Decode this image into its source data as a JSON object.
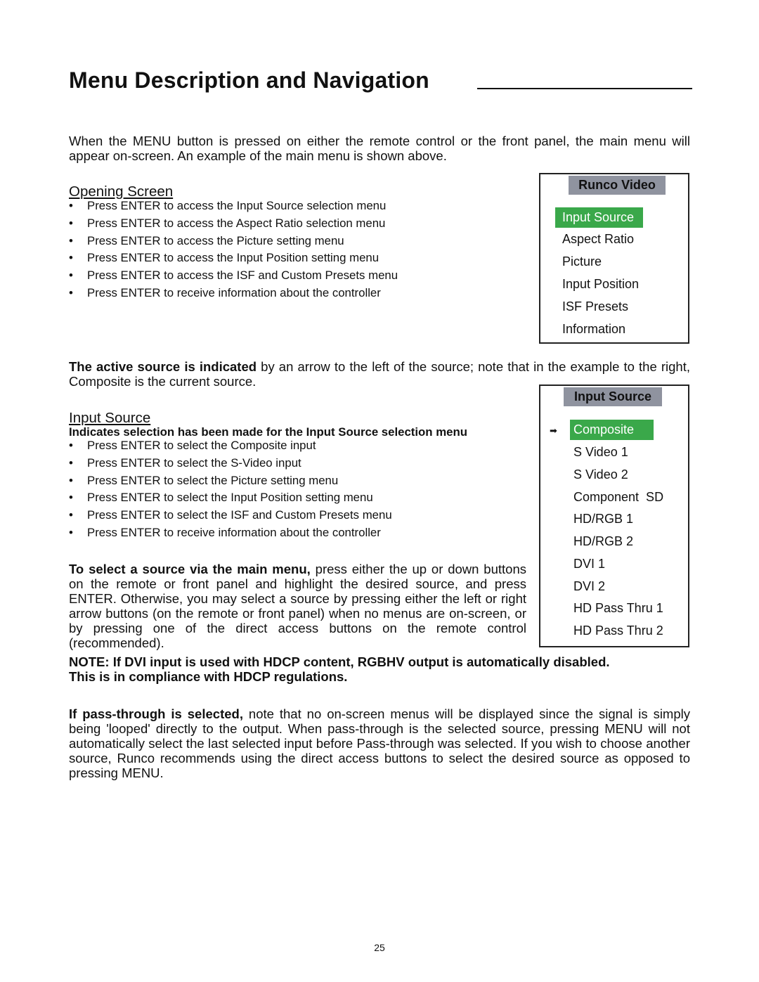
{
  "page": {
    "title": "Menu Description and Navigation",
    "intro": "When the MENU button is pressed on either the remote control or the front panel, the main menu will appear on-screen. An example of the main menu is shown above.",
    "opening_screen": {
      "heading": "Opening Screen",
      "bullets": [
        "Press ENTER to access the Input Source selection menu",
        "Press ENTER to access the Aspect Ratio selection menu",
        "Press ENTER to access the Picture setting menu",
        "Press ENTER to access the Input Position setting menu",
        "Press ENTER to access the ISF and Custom Presets menu",
        "Press ENTER to receive information about the controller"
      ]
    },
    "active_source": {
      "bold": "The active source is indicated",
      "rest": " by an arrow to the left of the source; note that in the example to the right, Composite is the current source."
    },
    "input_source": {
      "heading": "Input Source",
      "subheading": "Indicates selection has been made for the Input Source selection menu",
      "bullets": [
        "Press ENTER to select the Composite input",
        "Press ENTER to select the S-Video input",
        "Press ENTER to select the Picture setting menu",
        "Press ENTER to select the Input Position setting menu",
        "Press ENTER to select the ISF and Custom Presets menu",
        "Press ENTER to receive information about the controller"
      ]
    },
    "select_source": {
      "bold": "To select a source via the main menu,",
      "rest": " press either the up or down buttons on the remote or front panel and highlight the desired source, and press ENTER. Otherwise, you may select a source by pressing either the left or right arrow buttons (on the remote or front panel) when no menus are on-screen, or by pressing one of the direct access buttons on the remote control (recommended)."
    },
    "note": {
      "line1": "NOTE: If DVI input is used with HDCP content, RGBHV output is automatically disabled.",
      "line2": "This is in compliance with HDCP regulations."
    },
    "pass_through": {
      "bold": "If pass-through is selected,",
      "rest": " note that no on-screen menus will be displayed since the signal is simply being 'looped' directly to the output. When pass-through is the selected source, pressing MENU will not automatically select the last selected input before Pass-through was selected. If you wish to choose another source, Runco recommends using the direct access buttons to select the desired source as opposed to pressing MENU."
    },
    "page_number": "25"
  },
  "main_menu": {
    "header": "Runco Video",
    "items": [
      "Input Source",
      "Aspect Ratio",
      "Picture",
      "Input Position",
      "ISF Presets",
      "Information"
    ],
    "selected_index": 0
  },
  "input_menu": {
    "header": "Input Source",
    "items": [
      "Composite",
      "S Video 1",
      "S Video 2",
      "Component  SD",
      "HD/RGB 1",
      "HD/RGB 2",
      "DVI 1",
      "DVI 2",
      "HD Pass Thru 1",
      "HD Pass Thru 2"
    ],
    "selected_index": 0,
    "active_index": 0,
    "active_arrow": "➡"
  },
  "colors": {
    "highlight": "#3aa84a",
    "menu_header": "#8f939f"
  }
}
